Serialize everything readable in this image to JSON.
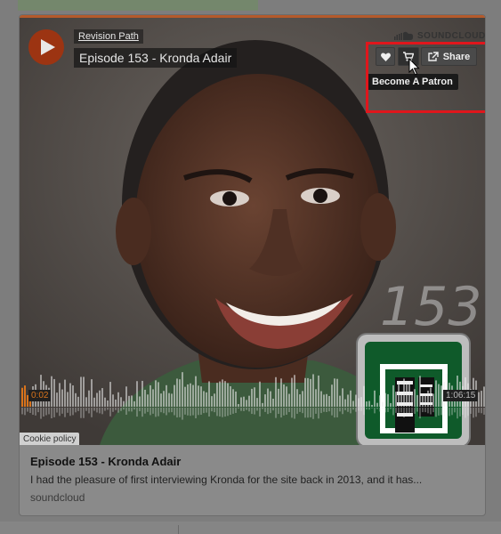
{
  "player": {
    "uploader": "Revision Path",
    "track_title": "Episode 153 - Kronda Adair",
    "brand": "SOUNDCLOUD",
    "share_label": "Share",
    "tooltip": "Become A Patron",
    "time_elapsed": "0:02",
    "time_total": "1:06:15",
    "artwork_number": "153",
    "cookie_policy": "Cookie policy"
  },
  "card": {
    "title": "Episode 153 - Kronda Adair",
    "description": "I had the pleasure of first interviewing Kronda for the site back in 2013, and it has...",
    "source": "soundcloud"
  },
  "icons": [
    "play-icon",
    "soundcloud-logo-icon",
    "heart-icon",
    "cart-icon",
    "share-icon",
    "cursor-icon"
  ],
  "colors": {
    "play": "#9c3412",
    "highlight": "#e0161c",
    "elapsed": "#d8731b",
    "tile_green": "#0f5a2a"
  },
  "progress_fraction": 0.0005
}
